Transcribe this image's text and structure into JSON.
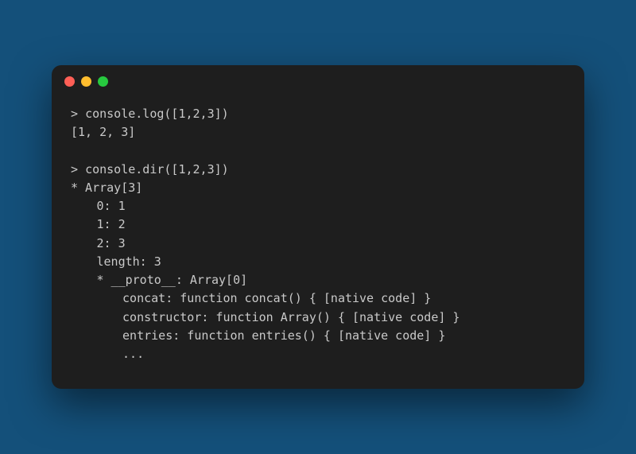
{
  "titlebar": {
    "dots": {
      "red": "#ff5f56",
      "yellow": "#ffbd2e",
      "green": "#27c93f"
    }
  },
  "console": {
    "prompt": ">",
    "block1": {
      "command": "console.log([1,2,3])",
      "output": "[1, 2, 3]"
    },
    "block2": {
      "command": "console.dir([1,2,3])",
      "line1": "* Array[3]",
      "items": {
        "i0": "0: 1",
        "i1": "1: 2",
        "i2": "2: 3",
        "length": "length: 3",
        "proto_header": "* __proto__: Array[0]"
      },
      "proto": {
        "concat": "concat: function concat() { [native code] }",
        "constructor": "constructor: function Array() { [native code] }",
        "entries": "entries: function entries() { [native code] }",
        "more": "..."
      }
    }
  }
}
